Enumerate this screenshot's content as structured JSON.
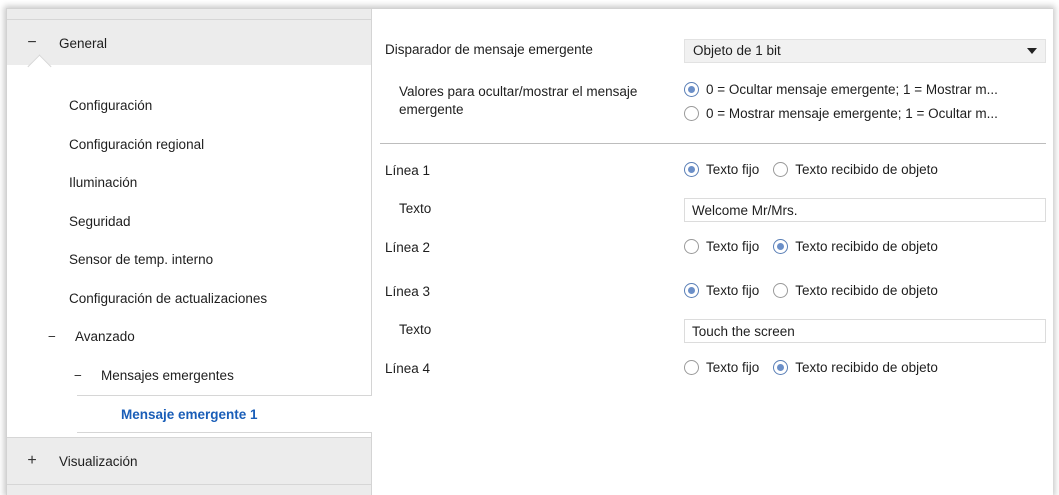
{
  "sidebar": {
    "groups": [
      {
        "sign": "−",
        "label": "General"
      },
      {
        "sign": "+",
        "label": "Visualización"
      }
    ],
    "items": [
      {
        "label": "Configuración"
      },
      {
        "label": "Configuración regional"
      },
      {
        "label": "Iluminación"
      },
      {
        "label": "Seguridad"
      },
      {
        "label": "Sensor de temp. interno"
      },
      {
        "label": "Configuración de actualizaciones"
      }
    ],
    "advanced": {
      "sign": "−",
      "label": "Avanzado"
    },
    "popups": {
      "sign": "−",
      "label": "Mensajes emergentes"
    },
    "selected": {
      "label": "Mensaje emergente 1"
    }
  },
  "main": {
    "trigger": {
      "label": "Disparador de mensaje emergente",
      "value": "Objeto de 1 bit"
    },
    "values": {
      "label_line1": "Valores para ocultar/mostrar el mensaje",
      "label_line2": "emergente",
      "options": [
        {
          "label": "0 = Ocultar mensaje emergente; 1 = Mostrar m...",
          "selected": true
        },
        {
          "label": "0 = Mostrar mensaje emergente; 1 = Ocultar m...",
          "selected": false
        }
      ]
    },
    "option_fixed": "Texto fijo",
    "option_object": "Texto recibido de objeto",
    "text_label": "Texto",
    "lines": [
      {
        "label": "Línea 1",
        "mode": "fixed",
        "text": "Welcome Mr/Mrs."
      },
      {
        "label": "Línea 2",
        "mode": "object"
      },
      {
        "label": "Línea 3",
        "mode": "fixed",
        "text": "Touch the screen"
      },
      {
        "label": "Línea 4",
        "mode": "object"
      }
    ]
  },
  "colors": {
    "selected_item_text": "#1a5eb8",
    "radio_dot": "#6b8fc8",
    "sidebar_bg": "#ececec"
  }
}
